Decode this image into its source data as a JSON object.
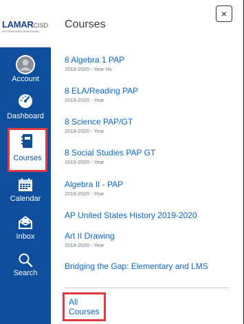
{
  "logo": {
    "brand": "LAMAR",
    "suffix": "CISD",
    "tagline": "INTERNATIONAL BARGAINING"
  },
  "sidebar": {
    "items": [
      {
        "label": "Account",
        "icon": "account-avatar-icon"
      },
      {
        "label": "Dashboard",
        "icon": "dashboard-gauge-icon"
      },
      {
        "label": "Courses",
        "icon": "courses-book-icon",
        "active": true
      },
      {
        "label": "Calendar",
        "icon": "calendar-icon"
      },
      {
        "label": "Inbox",
        "icon": "inbox-icon"
      },
      {
        "label": "Search",
        "icon": "search-icon"
      }
    ]
  },
  "tray": {
    "title": "Courses",
    "close_label": "×",
    "courses": [
      {
        "name": "8 Algebra 1 PAP",
        "term": "2019-2020 - Year Hs"
      },
      {
        "name": "8 ELA/Reading PAP",
        "term": "2019-2020 - Year"
      },
      {
        "name": "8 Science PAP/GT",
        "term": "2019-2020 - Year"
      },
      {
        "name": "8 Social Studies PAP GT",
        "term": "2019-2020 - Year"
      },
      {
        "name": "Algebra II - PAP",
        "term": "2019-2020 - Year"
      },
      {
        "name": "AP United States History 2019-2020",
        "term": ""
      },
      {
        "name": "Art II Drawing",
        "term": "2019-2020 - Year"
      },
      {
        "name": "Bridging the Gap: Elementary and LMS",
        "term": ""
      }
    ],
    "all_courses_label": "All Courses"
  },
  "colors": {
    "sidebar_bg": "#0d4f9c",
    "link": "#0d66c2",
    "highlight": "#e0393e"
  }
}
